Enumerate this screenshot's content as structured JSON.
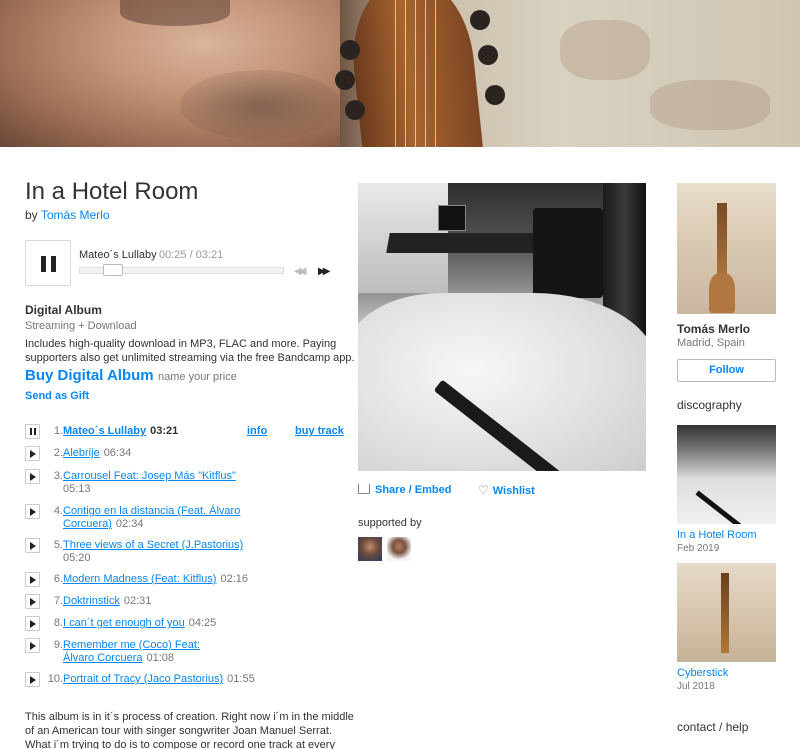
{
  "album": {
    "title": "In a Hotel Room",
    "by_prefix": "by",
    "artist": "Tomás Merlo"
  },
  "player": {
    "current_track": "Mateo´s Lullaby",
    "time": "00:25 / 03:21",
    "progress": 0.124,
    "state": "playing"
  },
  "purchase": {
    "format_title": "Digital Album",
    "format_sub": "Streaming + Download",
    "description": "Includes high-quality download in MP3, FLAC and more. Paying supporters also get unlimited streaming via the free Bandcamp app.",
    "buy_label": "Buy Digital Album",
    "price_note": "name your price",
    "gift_label": "Send as Gift"
  },
  "tracks": [
    {
      "num": "1.",
      "name": "Mateo´s Lullaby",
      "duration": "03:21",
      "current": true,
      "info": "info",
      "buy": "buy track"
    },
    {
      "num": "2.",
      "name": "Alebrije",
      "duration": "06:34"
    },
    {
      "num": "3.",
      "name": "Carrousel Feat: Josep Más \"Kitflus\"",
      "duration": "05:13"
    },
    {
      "num": "4.",
      "name": "Contigo en la distancia (Feat. Álvaro Corcuera)",
      "duration": "02:34"
    },
    {
      "num": "5.",
      "name": "Three views of a Secret (J.Pastorius)",
      "duration": "05:20"
    },
    {
      "num": "6.",
      "name": "Modern Madness (Feat: Kitflus)",
      "duration": "02:16"
    },
    {
      "num": "7.",
      "name": "Doktrinstick",
      "duration": "02:31"
    },
    {
      "num": "8.",
      "name": "I can´t get enough of you",
      "duration": "04:25"
    },
    {
      "num": "9.",
      "name": "Remember me (Coco) Feat: Álvaro Corcuera",
      "duration": "01:08"
    },
    {
      "num": "10.",
      "name": "Portrait of Tracy (Jaco Pastorius)",
      "duration": "01:55"
    }
  ],
  "about": "This album is in it´s process of creation. Right now i´m in the middle of an American tour with singer songwriter Joan Manuel Serrat. What i´m trying to do is to compose or record one track at every town, hotel,",
  "share": {
    "share_label": "Share / Embed",
    "wishlist_label": "Wishlist",
    "supported_by": "supported by"
  },
  "artist_panel": {
    "name": "Tomás Merlo",
    "location": "Madrid, Spain",
    "follow_label": "Follow",
    "discography_heading": "discography",
    "discography": [
      {
        "title": "In a Hotel Room",
        "date": "Feb 2019"
      },
      {
        "title": "Cyberstick",
        "date": "Jul 2018"
      }
    ],
    "contact_label": "contact / help"
  },
  "colors": {
    "link": "#0687f5",
    "text": "#333333",
    "muted": "#777777"
  }
}
